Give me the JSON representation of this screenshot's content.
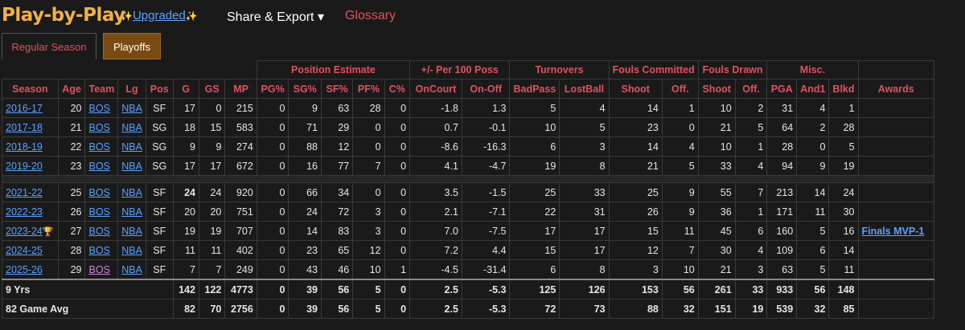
{
  "header": {
    "title": "Play-by-Play",
    "upgraded": "Upgraded",
    "spark": "✨",
    "share": "Share & Export ▾",
    "glossary": "Glossary"
  },
  "tabs": {
    "regular": "Regular Season",
    "playoffs": "Playoffs"
  },
  "groups": {
    "position": "Position Estimate",
    "plusminus": "+/- Per 100 Poss",
    "turnovers": "Turnovers",
    "fouls_committed": "Fouls Committed",
    "fouls_drawn": "Fouls Drawn",
    "misc": "Misc."
  },
  "columns": [
    "Season",
    "Age",
    "Team",
    "Lg",
    "Pos",
    "G",
    "GS",
    "MP",
    "PG%",
    "SG%",
    "SF%",
    "PF%",
    "C%",
    "OnCourt",
    "On-Off",
    "BadPass",
    "LostBall",
    "Shoot",
    "Off.",
    "Shoot",
    "Off.",
    "PGA",
    "And1",
    "Blkd",
    "Awards"
  ],
  "rows": [
    {
      "season": "2016-17",
      "age": "20",
      "team": "BOS",
      "lg": "NBA",
      "pos": "SF",
      "g": "17",
      "gs": "0",
      "mp": "215",
      "pg": "0",
      "sg": "9",
      "sf": "63",
      "pf": "28",
      "c": "0",
      "on": "-1.8",
      "onoff": "1.3",
      "bad": "5",
      "lost": "4",
      "fcs": "14",
      "fco": "1",
      "fds": "10",
      "fdo": "2",
      "pga": "31",
      "and1": "4",
      "blkd": "1",
      "award": ""
    },
    {
      "season": "2017-18",
      "age": "21",
      "team": "BOS",
      "lg": "NBA",
      "pos": "SG",
      "g": "18",
      "gs": "15",
      "mp": "583",
      "pg": "0",
      "sg": "71",
      "sf": "29",
      "pf": "0",
      "c": "0",
      "on": "0.7",
      "onoff": "-0.1",
      "bad": "10",
      "lost": "5",
      "fcs": "23",
      "fco": "0",
      "fds": "21",
      "fdo": "5",
      "pga": "64",
      "and1": "2",
      "blkd": "28",
      "award": ""
    },
    {
      "season": "2018-19",
      "age": "22",
      "team": "BOS",
      "lg": "NBA",
      "pos": "SG",
      "g": "9",
      "gs": "9",
      "mp": "274",
      "pg": "0",
      "sg": "88",
      "sf": "12",
      "pf": "0",
      "c": "0",
      "on": "-8.6",
      "onoff": "-16.3",
      "bad": "6",
      "lost": "3",
      "fcs": "14",
      "fco": "4",
      "fds": "10",
      "fdo": "1",
      "pga": "28",
      "and1": "0",
      "blkd": "5",
      "award": ""
    },
    {
      "season": "2019-20",
      "age": "23",
      "team": "BOS",
      "lg": "NBA",
      "pos": "SG",
      "g": "17",
      "gs": "17",
      "mp": "672",
      "pg": "0",
      "sg": "16",
      "sf": "77",
      "pf": "7",
      "c": "0",
      "on": "4.1",
      "onoff": "-4.7",
      "bad": "19",
      "lost": "8",
      "fcs": "21",
      "fco": "5",
      "fds": "33",
      "fdo": "4",
      "pga": "94",
      "and1": "9",
      "blkd": "19",
      "award": ""
    },
    {
      "spacer": true
    },
    {
      "season": "2021-22",
      "age": "25",
      "team": "BOS",
      "lg": "NBA",
      "pos": "SF",
      "g": "24",
      "gs": "24",
      "mp": "920",
      "pg": "0",
      "sg": "66",
      "sf": "34",
      "pf": "0",
      "c": "0",
      "on": "3.5",
      "onoff": "-1.5",
      "bad": "25",
      "lost": "33",
      "fcs": "25",
      "fco": "9",
      "fds": "55",
      "fdo": "7",
      "pga": "213",
      "and1": "14",
      "blkd": "24",
      "award": "",
      "gbold": true
    },
    {
      "season": "2022-23",
      "age": "26",
      "team": "BOS",
      "lg": "NBA",
      "pos": "SF",
      "g": "20",
      "gs": "20",
      "mp": "751",
      "pg": "0",
      "sg": "24",
      "sf": "72",
      "pf": "3",
      "c": "0",
      "on": "2.1",
      "onoff": "-7.1",
      "bad": "22",
      "lost": "31",
      "fcs": "26",
      "fco": "9",
      "fds": "36",
      "fdo": "1",
      "pga": "171",
      "and1": "11",
      "blkd": "30",
      "award": ""
    },
    {
      "season": "2023-24",
      "trophy": "🏆",
      "age": "27",
      "team": "BOS",
      "lg": "NBA",
      "pos": "SF",
      "g": "19",
      "gs": "19",
      "mp": "707",
      "pg": "0",
      "sg": "14",
      "sf": "83",
      "pf": "3",
      "c": "0",
      "on": "7.0",
      "onoff": "-7.5",
      "bad": "17",
      "lost": "17",
      "fcs": "15",
      "fco": "11",
      "fds": "45",
      "fdo": "6",
      "pga": "160",
      "and1": "5",
      "blkd": "16",
      "award": "Finals MVP-1"
    },
    {
      "season": "2024-25",
      "age": "28",
      "team": "BOS",
      "lg": "NBA",
      "pos": "SF",
      "g": "11",
      "gs": "11",
      "mp": "402",
      "pg": "0",
      "sg": "23",
      "sf": "65",
      "pf": "12",
      "c": "0",
      "on": "7.2",
      "onoff": "4.4",
      "bad": "15",
      "lost": "17",
      "fcs": "12",
      "fco": "7",
      "fds": "30",
      "fdo": "4",
      "pga": "109",
      "and1": "6",
      "blkd": "14",
      "award": ""
    },
    {
      "season": "2025-26",
      "age": "29",
      "team": "BOS",
      "teamVisited": true,
      "lg": "NBA",
      "pos": "SF",
      "g": "7",
      "gs": "7",
      "mp": "249",
      "pg": "0",
      "sg": "43",
      "sf": "46",
      "pf": "10",
      "c": "1",
      "on": "-4.5",
      "onoff": "-31.4",
      "bad": "6",
      "lost": "8",
      "fcs": "3",
      "fco": "10",
      "fds": "21",
      "fdo": "3",
      "pga": "63",
      "and1": "5",
      "blkd": "11",
      "award": ""
    }
  ],
  "footer": [
    {
      "label": "9 Yrs",
      "g": "142",
      "gs": "122",
      "mp": "4773",
      "pg": "0",
      "sg": "39",
      "sf": "56",
      "pf": "5",
      "c": "0",
      "on": "2.5",
      "onoff": "-5.3",
      "bad": "125",
      "lost": "126",
      "fcs": "153",
      "fco": "56",
      "fds": "261",
      "fdo": "33",
      "pga": "933",
      "and1": "56",
      "blkd": "148"
    },
    {
      "label": "82 Game Avg",
      "g": "82",
      "gs": "70",
      "mp": "2756",
      "pg": "0",
      "sg": "39",
      "sf": "56",
      "pf": "5",
      "c": "0",
      "on": "2.5",
      "onoff": "-5.3",
      "bad": "72",
      "lost": "73",
      "fcs": "88",
      "fco": "32",
      "fds": "151",
      "fdo": "19",
      "pga": "539",
      "and1": "32",
      "blkd": "85"
    }
  ],
  "colors": {
    "positive": "#5fd35f",
    "negative": "#e0525f",
    "link": "#5aa2ff",
    "accent": "#f0b04a"
  }
}
